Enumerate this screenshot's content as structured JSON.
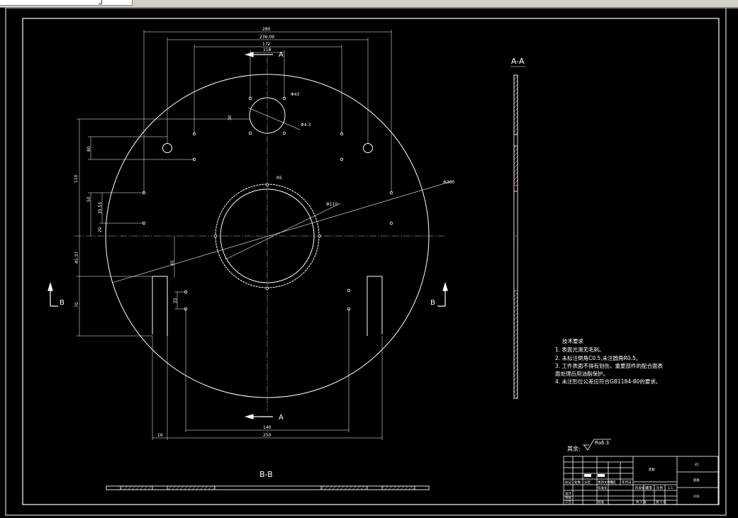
{
  "toolbar": {
    "field": ""
  },
  "views": {
    "section_aa": "A-A",
    "section_bb": "B-B"
  },
  "markers": {
    "a_top": "A",
    "a_bottom": "A",
    "b_left": "B",
    "b_right": "B"
  },
  "dimensions": {
    "top_280": "280",
    "top_236": "236.09",
    "top_172": "172",
    "top_118": "118",
    "d_hole_top": "Φ43",
    "d_hole_small": "Φ4.3",
    "d_outer": "Φ360",
    "d_inner": "Φ110",
    "r_a": "R5",
    "left_110": "110",
    "left_80": "80",
    "left_50": "50",
    "left_35": "35.55",
    "left_20": "20",
    "left_45": "45.37",
    "left_70": "70",
    "h_30": "30",
    "h_25": "25",
    "d_45": "45",
    "bottom_140": "140",
    "bottom_250": "250",
    "bottom_16": "16"
  },
  "notes": {
    "title": "技术要求",
    "lines": [
      "1. 表面光滑无毛刺。",
      "2. 未标注倒角C0.5,未注圆角R0.5。",
      "3. 工件表面不得有划伤，重要部件的配合面表",
      "面处理后用油脂保护。",
      "4. 未注形位公差应符合GB1184-80的要求。"
    ]
  },
  "roughness": {
    "label": "其余:",
    "value": "Ra6.3"
  },
  "title_block": {
    "part_name": "底板",
    "material": "45",
    "drawing_no": "底板",
    "scale": "1:1",
    "sheet": "共 1 张",
    "sheet2": "第 1 张",
    "mark1": "标记",
    "mark2": "处数",
    "mark3": "分区",
    "mark4": "更改文件号",
    "mark5": "签名",
    "mark6": "年月日",
    "designer": "设计",
    "standard": "标准化",
    "stage": "阶段标记",
    "weight": "重量",
    "ratio": "比例",
    "checker": "审核",
    "process": "工艺",
    "approve": "批准",
    "count": "200"
  },
  "colors": {
    "background": "#000000",
    "line": "#ffffff",
    "hatch": "#ff3b3b",
    "center": "#c8c8c8"
  }
}
